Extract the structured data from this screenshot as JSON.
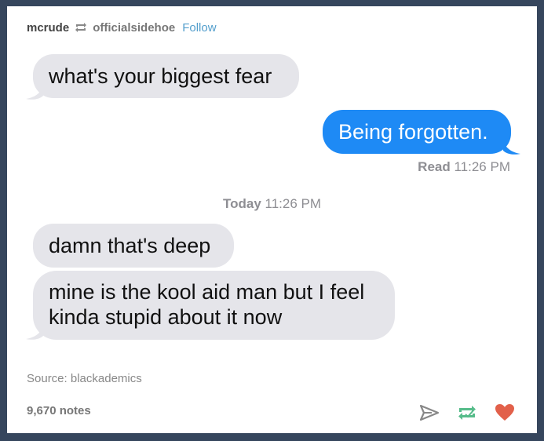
{
  "header": {
    "username": "mcrude",
    "reblogged_from": "officialsidehoe",
    "follow_label": "Follow"
  },
  "messages": {
    "m1": "what's your biggest fear",
    "m2": "Being forgotten.",
    "m3": "damn that's deep",
    "m4_line1": "mine is the kool aid man but I feel",
    "m4_line2": "kinda stupid about it now"
  },
  "read_receipt": {
    "label": "Read",
    "time": "11:26 PM"
  },
  "timestamp": {
    "label": "Today",
    "time": "11:26 PM"
  },
  "source": "Source: blackademics",
  "notes": "9,670 notes",
  "colors": {
    "outgoing": "#1e8af5",
    "incoming": "#e5e5ea",
    "background": "#36465d",
    "like": "#e2604a",
    "reblog": "#56bc8a"
  },
  "icons": [
    "reblog-icon",
    "share-icon",
    "reblog-action-icon",
    "heart-icon"
  ]
}
